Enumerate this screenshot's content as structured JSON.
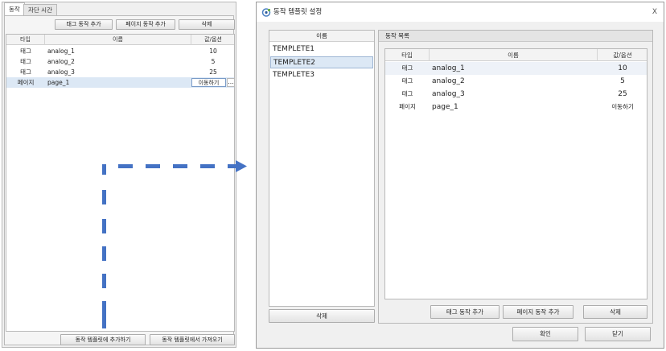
{
  "left": {
    "tabs": [
      "동작",
      "자단 시간"
    ],
    "toolbar": {
      "add_tag": "태그 동작 추가",
      "add_page": "페이지 동작 추가",
      "delete": "삭제"
    },
    "columns": [
      "타입",
      "이름",
      "값/옵션"
    ],
    "rows": [
      {
        "type": "태그",
        "name": "analog_1",
        "value": "10"
      },
      {
        "type": "태그",
        "name": "analog_2",
        "value": "5"
      },
      {
        "type": "태그",
        "name": "analog_3",
        "value": "25"
      },
      {
        "type": "페이지",
        "name": "page_1",
        "value": "이동하기",
        "more": "..."
      }
    ],
    "bottom": {
      "add_to_template": "동작 템플릿에 추가하기",
      "load_from_template": "동작 템플릿에서 가져오기"
    }
  },
  "dialog": {
    "title": "동작 템플릿 설정",
    "close": "X",
    "template_list": {
      "header": "이름",
      "items": [
        "TEMPLETE1",
        "TEMPLETE2",
        "TEMPLETE3"
      ],
      "selected_index": 1,
      "delete": "삭제"
    },
    "action_list": {
      "label": "동작 목록",
      "columns": [
        "타입",
        "이름",
        "값/옵션"
      ],
      "rows": [
        {
          "type": "태그",
          "name": "analog_1",
          "value": "10"
        },
        {
          "type": "태그",
          "name": "analog_2",
          "value": "5"
        },
        {
          "type": "태그",
          "name": "analog_3",
          "value": "25"
        },
        {
          "type": "페이지",
          "name": "page_1",
          "value": "이동하기"
        }
      ],
      "buttons": {
        "add_tag": "태그 동작 추가",
        "add_page": "페이지 동작 추가",
        "delete": "삭제"
      }
    },
    "footer": {
      "ok": "확인",
      "close": "닫기"
    }
  },
  "colors": {
    "arrow": "#4472c4",
    "selection": "#dce8f5"
  }
}
